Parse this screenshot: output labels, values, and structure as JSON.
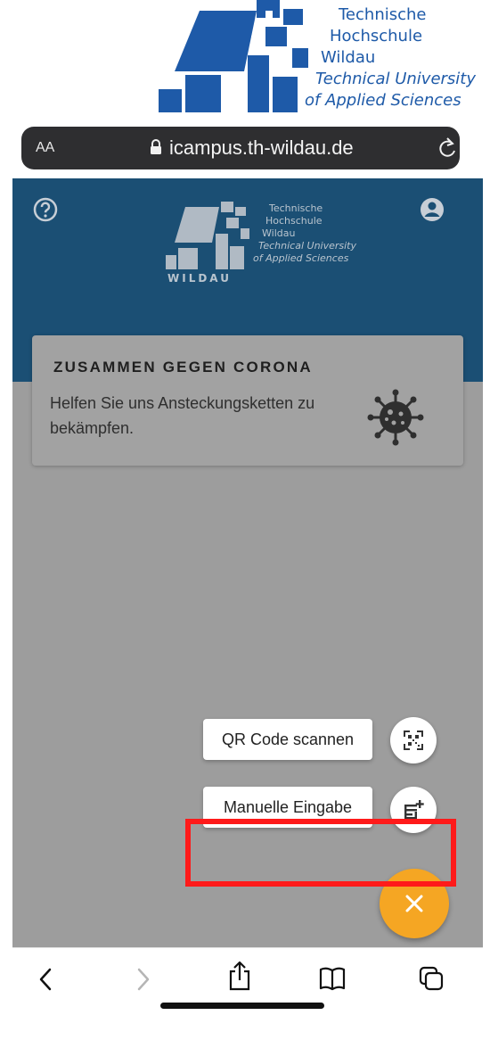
{
  "brand_logo": {
    "line1": "Technische",
    "line2": "Hochschule",
    "line3": "Wildau",
    "line4": "Technical University",
    "line5": "of Applied Sciences"
  },
  "browser": {
    "text_size_label": "AA",
    "url": "icampus.th-wildau.de"
  },
  "app_header": {
    "logo_line1": "Technische",
    "logo_line2": "Hochschule",
    "logo_line3": "Wildau",
    "logo_line4": "Technical University",
    "logo_line5": "of Applied Sciences",
    "logo_word": "WILDAU"
  },
  "corona_card": {
    "title": "ZUSAMMEN GEGEN CORONA",
    "body": "Helfen Sie uns Ansteckungsketten zu bekämpfen."
  },
  "speed_dial": {
    "qr_label": "QR Code scannen",
    "manual_label": "Manuelle Eingabe"
  },
  "colors": {
    "header_blue": "#1b4f74",
    "fab_orange": "#f5a623",
    "highlight_red": "#ff1a1a",
    "brand_blue": "#1e5aa8"
  }
}
